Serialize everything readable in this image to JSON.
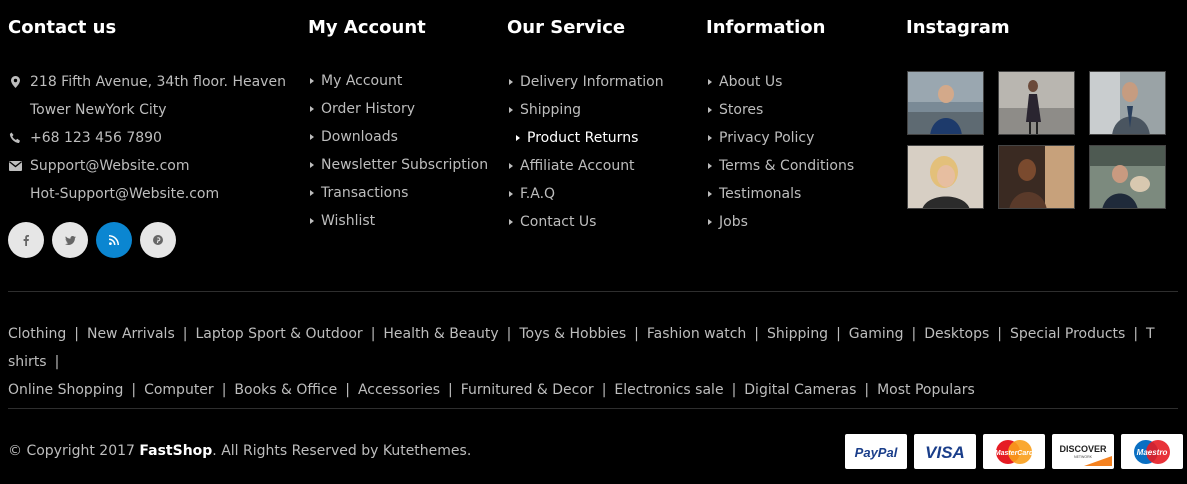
{
  "contact": {
    "title": "Contact us",
    "address_line1": "218 Fifth Avenue, 34th floor. Heaven",
    "address_line2": "Tower NewYork City",
    "phone": "+68 123 456 7890",
    "email1": "Support@Website.com",
    "email2": "Hot-Support@Website.com",
    "social": [
      {
        "icon": "facebook-icon",
        "glyph": "f"
      },
      {
        "icon": "twitter-icon",
        "glyph": "t"
      },
      {
        "icon": "rss-icon",
        "glyph": "rss"
      },
      {
        "icon": "pinterest-icon",
        "glyph": "p"
      }
    ],
    "social_active_color": "#0b86d1"
  },
  "account": {
    "title": "My Account",
    "items": [
      "My Account",
      "Order History",
      "Downloads",
      "Newsletter Subscription",
      "Transactions",
      "Wishlist"
    ]
  },
  "service": {
    "title": "Our Service",
    "items": [
      "Delivery Information",
      "Shipping",
      "Product Returns",
      "Affiliate Account",
      "F.A.Q",
      "Contact Us"
    ]
  },
  "information": {
    "title": "Information",
    "items": [
      "About Us",
      "Stores",
      "Privacy Policy",
      "Terms & Conditions",
      "Testimonals",
      "Jobs"
    ]
  },
  "instagram": {
    "title": "Instagram"
  },
  "tags": {
    "row1": [
      "Clothing",
      "New Arrivals",
      "Laptop Sport & Outdoor",
      "Health & Beauty",
      "Toys & Hobbies",
      "Fashion watch",
      "Shipping",
      "Gaming",
      "Desktops",
      "Special Products",
      "T shirts"
    ],
    "row2": [
      "Online Shopping",
      "Computer",
      "Books & Office",
      "Accessories",
      "Furnitured & Decor",
      "Electronics sale",
      "Digital Cameras",
      "Most Populars"
    ]
  },
  "footer": {
    "copyright_prefix": "© Copyright 2017 ",
    "brand": "FastShop",
    "copyright_suffix": ". All Rights Reserved by Kutethemes."
  },
  "payments": {
    "paypal": "PayPal",
    "visa": "VISA",
    "mastercard": "MasterCard",
    "discover": "DISCOVER",
    "discover_sub": "NETWORK",
    "maestro": "Maestro"
  }
}
